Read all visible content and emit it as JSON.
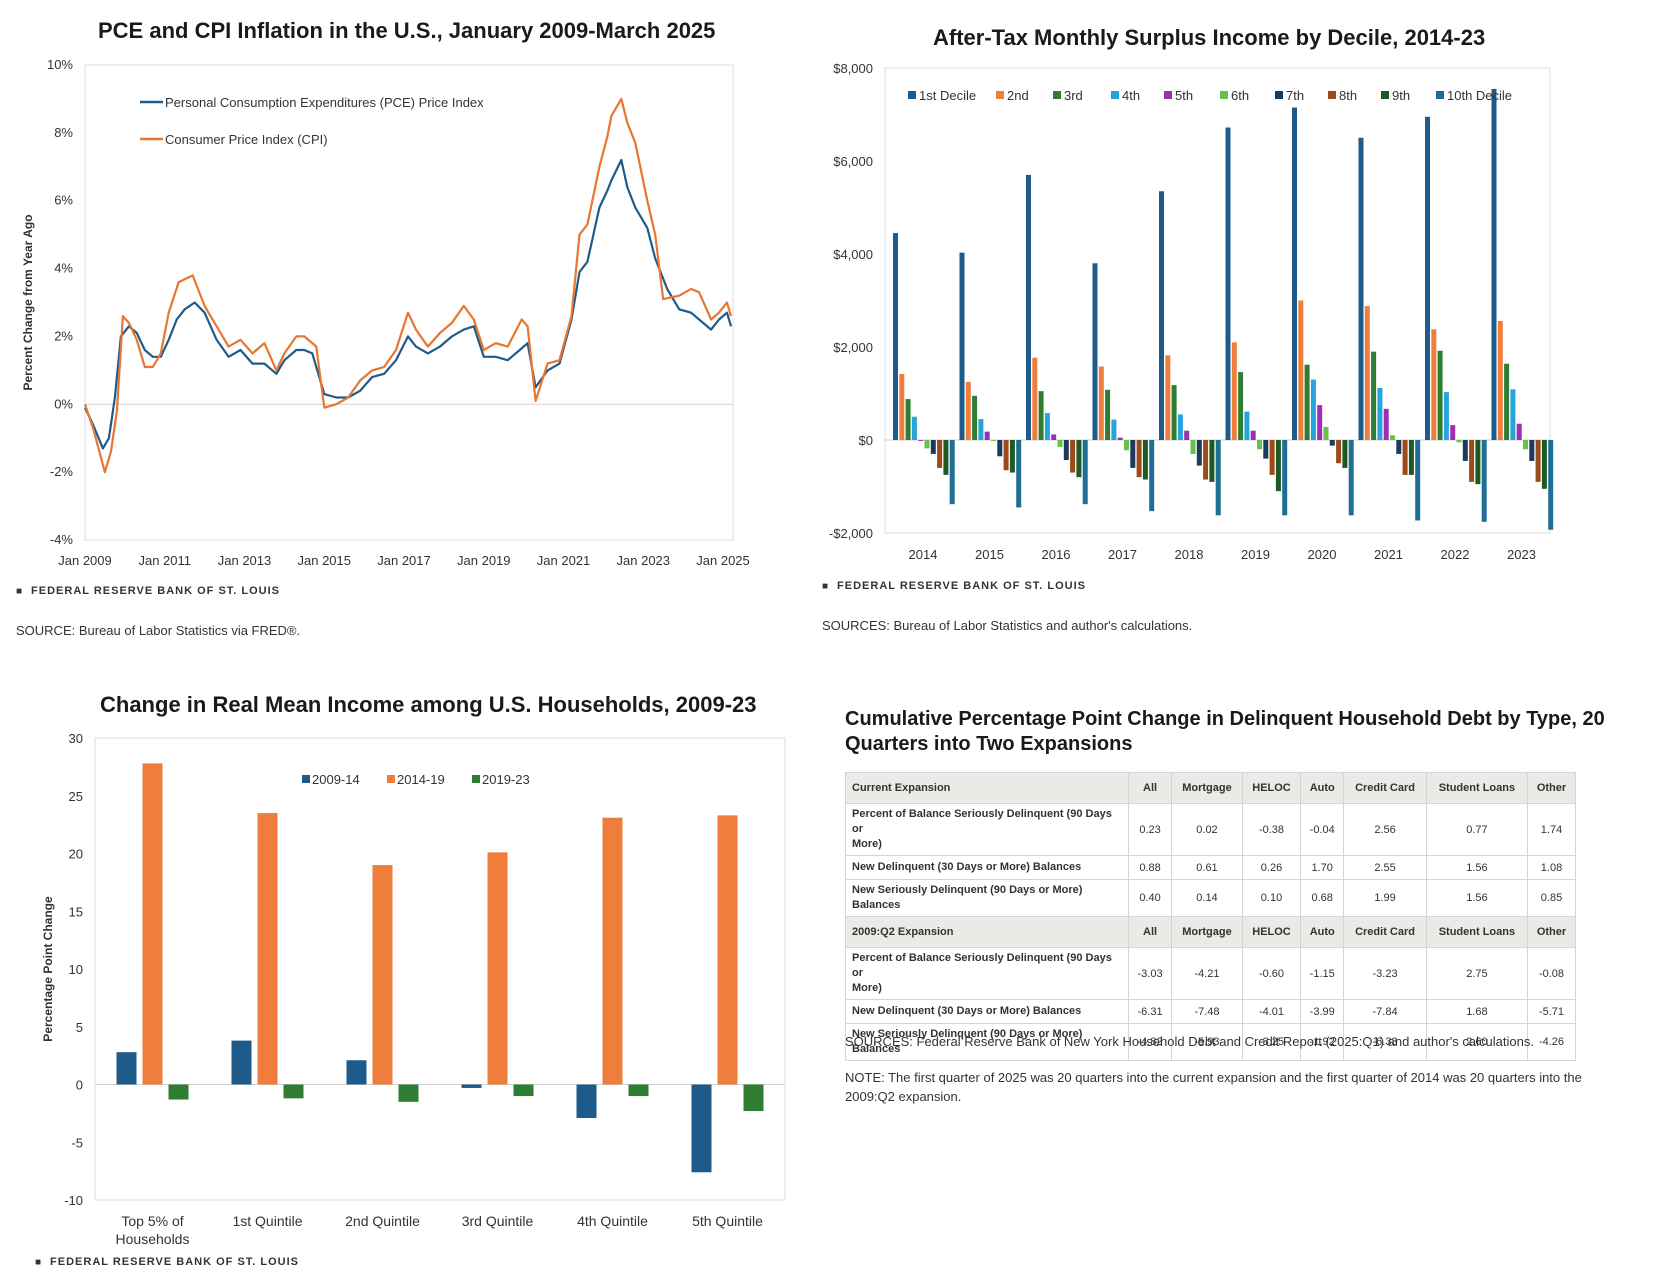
{
  "footer_brand": "FEDERAL RESERVE BANK OF ST. LOUIS",
  "chart_data": [
    {
      "type": "line",
      "title": "PCE and CPI Inflation in the U.S., January 2009-March 2025",
      "ylabel": "Percent Change from Year Ago",
      "ylim": [
        -4,
        10
      ],
      "yticks": [
        "10%",
        "8%",
        "6%",
        "4%",
        "2%",
        "0%",
        "-2%",
        "-4%"
      ],
      "xticks": [
        "Jan 2009",
        "Jan 2011",
        "Jan 2013",
        "Jan 2015",
        "Jan 2017",
        "Jan 2019",
        "Jan 2021",
        "Jan 2023",
        "Jan 2025"
      ],
      "xrange": [
        2009.0,
        2025.25
      ],
      "legend_position": "top-left",
      "source": "SOURCE: Bureau of Labor Statistics via FRED®.",
      "series": [
        {
          "name": "Personal Consumption Expenditures (PCE) Price Index",
          "color": "#1f5b8a",
          "points": [
            [
              2009.0,
              -0.1
            ],
            [
              2009.2,
              -0.6
            ],
            [
              2009.45,
              -1.3
            ],
            [
              2009.6,
              -1.0
            ],
            [
              2009.75,
              0.2
            ],
            [
              2009.9,
              2.0
            ],
            [
              2010.1,
              2.3
            ],
            [
              2010.3,
              2.1
            ],
            [
              2010.5,
              1.6
            ],
            [
              2010.7,
              1.4
            ],
            [
              2010.9,
              1.4
            ],
            [
              2011.1,
              1.9
            ],
            [
              2011.3,
              2.5
            ],
            [
              2011.5,
              2.8
            ],
            [
              2011.75,
              3.0
            ],
            [
              2012.0,
              2.7
            ],
            [
              2012.3,
              1.9
            ],
            [
              2012.6,
              1.4
            ],
            [
              2012.9,
              1.6
            ],
            [
              2013.2,
              1.2
            ],
            [
              2013.5,
              1.2
            ],
            [
              2013.8,
              0.9
            ],
            [
              2014.0,
              1.3
            ],
            [
              2014.3,
              1.6
            ],
            [
              2014.5,
              1.6
            ],
            [
              2014.7,
              1.5
            ],
            [
              2015.0,
              0.3
            ],
            [
              2015.3,
              0.2
            ],
            [
              2015.6,
              0.2
            ],
            [
              2015.9,
              0.4
            ],
            [
              2016.2,
              0.8
            ],
            [
              2016.5,
              0.9
            ],
            [
              2016.8,
              1.3
            ],
            [
              2017.1,
              2.0
            ],
            [
              2017.3,
              1.7
            ],
            [
              2017.6,
              1.5
            ],
            [
              2017.9,
              1.7
            ],
            [
              2018.2,
              2.0
            ],
            [
              2018.5,
              2.2
            ],
            [
              2018.75,
              2.3
            ],
            [
              2019.0,
              1.4
            ],
            [
              2019.3,
              1.4
            ],
            [
              2019.6,
              1.3
            ],
            [
              2019.9,
              1.6
            ],
            [
              2020.1,
              1.8
            ],
            [
              2020.3,
              0.5
            ],
            [
              2020.6,
              1.0
            ],
            [
              2020.9,
              1.2
            ],
            [
              2021.2,
              2.5
            ],
            [
              2021.4,
              3.9
            ],
            [
              2021.6,
              4.2
            ],
            [
              2021.9,
              5.8
            ],
            [
              2022.1,
              6.3
            ],
            [
              2022.2,
              6.6
            ],
            [
              2022.45,
              7.2
            ],
            [
              2022.6,
              6.4
            ],
            [
              2022.8,
              5.8
            ],
            [
              2023.1,
              5.2
            ],
            [
              2023.3,
              4.3
            ],
            [
              2023.6,
              3.4
            ],
            [
              2023.9,
              2.8
            ],
            [
              2024.2,
              2.7
            ],
            [
              2024.4,
              2.5
            ],
            [
              2024.7,
              2.2
            ],
            [
              2024.9,
              2.5
            ],
            [
              2025.1,
              2.7
            ],
            [
              2025.2,
              2.3
            ]
          ]
        },
        {
          "name": "Consumer Price Index (CPI)",
          "color": "#e87530",
          "points": [
            [
              2009.0,
              0.0
            ],
            [
              2009.2,
              -0.7
            ],
            [
              2009.5,
              -2.0
            ],
            [
              2009.65,
              -1.4
            ],
            [
              2009.8,
              -0.2
            ],
            [
              2009.95,
              2.6
            ],
            [
              2010.1,
              2.4
            ],
            [
              2010.3,
              1.9
            ],
            [
              2010.5,
              1.1
            ],
            [
              2010.7,
              1.1
            ],
            [
              2010.9,
              1.5
            ],
            [
              2011.1,
              2.7
            ],
            [
              2011.35,
              3.6
            ],
            [
              2011.7,
              3.8
            ],
            [
              2012.0,
              2.9
            ],
            [
              2012.3,
              2.3
            ],
            [
              2012.6,
              1.7
            ],
            [
              2012.9,
              1.9
            ],
            [
              2013.2,
              1.5
            ],
            [
              2013.5,
              1.8
            ],
            [
              2013.8,
              1.0
            ],
            [
              2014.0,
              1.5
            ],
            [
              2014.3,
              2.0
            ],
            [
              2014.5,
              2.0
            ],
            [
              2014.8,
              1.7
            ],
            [
              2015.0,
              -0.1
            ],
            [
              2015.3,
              0.0
            ],
            [
              2015.6,
              0.2
            ],
            [
              2015.9,
              0.7
            ],
            [
              2016.2,
              1.0
            ],
            [
              2016.5,
              1.1
            ],
            [
              2016.8,
              1.6
            ],
            [
              2017.1,
              2.7
            ],
            [
              2017.3,
              2.2
            ],
            [
              2017.6,
              1.7
            ],
            [
              2017.9,
              2.1
            ],
            [
              2018.2,
              2.4
            ],
            [
              2018.5,
              2.9
            ],
            [
              2018.75,
              2.5
            ],
            [
              2019.0,
              1.6
            ],
            [
              2019.3,
              1.8
            ],
            [
              2019.6,
              1.7
            ],
            [
              2019.95,
              2.5
            ],
            [
              2020.1,
              2.3
            ],
            [
              2020.3,
              0.1
            ],
            [
              2020.6,
              1.2
            ],
            [
              2020.9,
              1.3
            ],
            [
              2021.2,
              2.6
            ],
            [
              2021.4,
              5.0
            ],
            [
              2021.6,
              5.3
            ],
            [
              2021.9,
              7.0
            ],
            [
              2022.1,
              7.9
            ],
            [
              2022.2,
              8.5
            ],
            [
              2022.45,
              9.0
            ],
            [
              2022.6,
              8.3
            ],
            [
              2022.8,
              7.7
            ],
            [
              2023.1,
              6.0
            ],
            [
              2023.3,
              5.0
            ],
            [
              2023.5,
              3.1
            ],
            [
              2023.9,
              3.2
            ],
            [
              2024.2,
              3.4
            ],
            [
              2024.4,
              3.3
            ],
            [
              2024.7,
              2.5
            ],
            [
              2024.9,
              2.7
            ],
            [
              2025.1,
              3.0
            ],
            [
              2025.2,
              2.6
            ]
          ]
        }
      ]
    },
    {
      "type": "bar",
      "title": "After-Tax Monthly Surplus Income by Decile, 2014-23",
      "ylim": [
        -2000,
        8000
      ],
      "yticks": [
        "$8,000",
        "$6,000",
        "$4,000",
        "$2,000",
        "$0",
        "-$2,000"
      ],
      "categories": [
        "2014",
        "2015",
        "2016",
        "2017",
        "2018",
        "2019",
        "2020",
        "2021",
        "2022",
        "2023"
      ],
      "legend_position": "top",
      "source": "SOURCES: Bureau of Labor Statistics and author's calculations.",
      "series": [
        {
          "name": "1st Decile",
          "color": "#1f5b8a",
          "values": [
            4450,
            4030,
            5700,
            3800,
            5350,
            6720,
            7150,
            6500,
            6950,
            7550
          ]
        },
        {
          "name": "2nd",
          "color": "#ef7d3c",
          "values": [
            1420,
            1250,
            1770,
            1580,
            1820,
            2100,
            3000,
            2880,
            2380,
            2560
          ]
        },
        {
          "name": "3rd",
          "color": "#2e7d32",
          "values": [
            880,
            950,
            1050,
            1080,
            1180,
            1460,
            1620,
            1900,
            1920,
            1640
          ]
        },
        {
          "name": "4th",
          "color": "#29a3dd",
          "values": [
            500,
            450,
            580,
            440,
            550,
            610,
            1300,
            1120,
            1030,
            1090
          ]
        },
        {
          "name": "5th",
          "color": "#9b30b2",
          "values": [
            -20,
            180,
            120,
            50,
            200,
            200,
            750,
            670,
            320,
            350
          ]
        },
        {
          "name": "6th",
          "color": "#6abf4b",
          "values": [
            -180,
            -20,
            -150,
            -220,
            -300,
            -200,
            280,
            100,
            -50,
            -200
          ]
        },
        {
          "name": "7th",
          "color": "#1b3a5c",
          "values": [
            -300,
            -350,
            -430,
            -600,
            -550,
            -400,
            -120,
            -300,
            -450,
            -450
          ]
        },
        {
          "name": "8th",
          "color": "#9c4a1a",
          "values": [
            -600,
            -650,
            -700,
            -800,
            -850,
            -750,
            -500,
            -750,
            -900,
            -900
          ]
        },
        {
          "name": "9th",
          "color": "#1e5a24",
          "values": [
            -750,
            -700,
            -800,
            -850,
            -900,
            -1100,
            -600,
            -750,
            -950,
            -1050
          ]
        },
        {
          "name": "10th Decile",
          "color": "#1f6e93",
          "values": [
            -1380,
            -1450,
            -1380,
            -1530,
            -1620,
            -1620,
            -1620,
            -1730,
            -1760,
            -1930
          ]
        }
      ]
    },
    {
      "type": "bar",
      "title": "Change in Real Mean Income among U.S. Households, 2009-23",
      "ylabel": "Percentage Point Change",
      "ylim": [
        -10,
        30
      ],
      "yticks": [
        "30",
        "25",
        "20",
        "15",
        "10",
        "5",
        "0",
        "-5",
        "-10"
      ],
      "categories": [
        [
          "Top 5% of",
          "Households"
        ],
        [
          "1st Quintile"
        ],
        [
          "2nd Quintile"
        ],
        [
          "3rd Quintile"
        ],
        [
          "4th Quintile"
        ],
        [
          "5th Quintile"
        ]
      ],
      "legend_position": "top",
      "series": [
        {
          "name": "2009-14",
          "color": "#1f5b8a",
          "values": [
            2.8,
            3.8,
            2.1,
            -0.3,
            -2.9,
            -7.6
          ]
        },
        {
          "name": "2014-19",
          "color": "#ef7d3c",
          "values": [
            27.8,
            23.5,
            19.0,
            20.1,
            23.1,
            23.3
          ]
        },
        {
          "name": "2019-23",
          "color": "#2e7d32",
          "values": [
            -1.3,
            -1.2,
            -1.5,
            -1.0,
            -1.0,
            -2.3
          ]
        }
      ]
    },
    {
      "type": "table",
      "title": [
        "Cumulative Percentage Point Change in Delinquent Household Debt by Type, 20",
        "Quarters into Two Expansions"
      ],
      "sections": [
        {
          "header": [
            "Current Expansion",
            "All",
            "Mortgage",
            "HELOC",
            "Auto",
            "Credit Card",
            "Student Loans",
            "Other"
          ],
          "rows": [
            {
              "label": [
                "Percent of Balance Seriously Delinquent (90 Days or",
                "More)"
              ],
              "values": [
                "0.23",
                "0.02",
                "-0.38",
                "-0.04",
                "2.56",
                "0.77",
                "1.74"
              ]
            },
            {
              "label": [
                "New Delinquent (30 Days or More) Balances"
              ],
              "values": [
                "0.88",
                "0.61",
                "0.26",
                "1.70",
                "2.55",
                "1.56",
                "1.08"
              ]
            },
            {
              "label": [
                "New Seriously Delinquent (90 Days or More) Balances"
              ],
              "values": [
                "0.40",
                "0.14",
                "0.10",
                "0.68",
                "1.99",
                "1.56",
                "0.85"
              ]
            }
          ]
        },
        {
          "header": [
            "2009:Q2 Expansion",
            "All",
            "Mortgage",
            "HELOC",
            "Auto",
            "Credit Card",
            "Student Loans",
            "Other"
          ],
          "rows": [
            {
              "label": [
                "Percent of Balance Seriously Delinquent (90 Days or",
                "More)"
              ],
              "values": [
                "-3.03",
                "-4.21",
                "-0.60",
                "-1.15",
                "-3.23",
                "2.75",
                "-0.08"
              ]
            },
            {
              "label": [
                "New Delinquent (30 Days or More) Balances"
              ],
              "values": [
                "-6.31",
                "-7.48",
                "-4.01",
                "-3.99",
                "-7.84",
                "1.68",
                "-5.71"
              ]
            },
            {
              "label": [
                "New Seriously Delinquent (90 Days or More) Balances"
              ],
              "values": [
                "-4.82",
                "-5.93",
                "-3.25",
                "-1.92",
                "-6.33",
                "2.60",
                "-4.26"
              ]
            }
          ]
        }
      ],
      "source": "SOURCES: Federal Reserve Bank of New York Household Debt and Credit Report (2025:Q1) and author's calculations.",
      "note": "NOTE: The first quarter of 2025 was 20 quarters into the current expansion and the first quarter of 2014 was 20 quarters into the 2009:Q2 expansion."
    }
  ]
}
